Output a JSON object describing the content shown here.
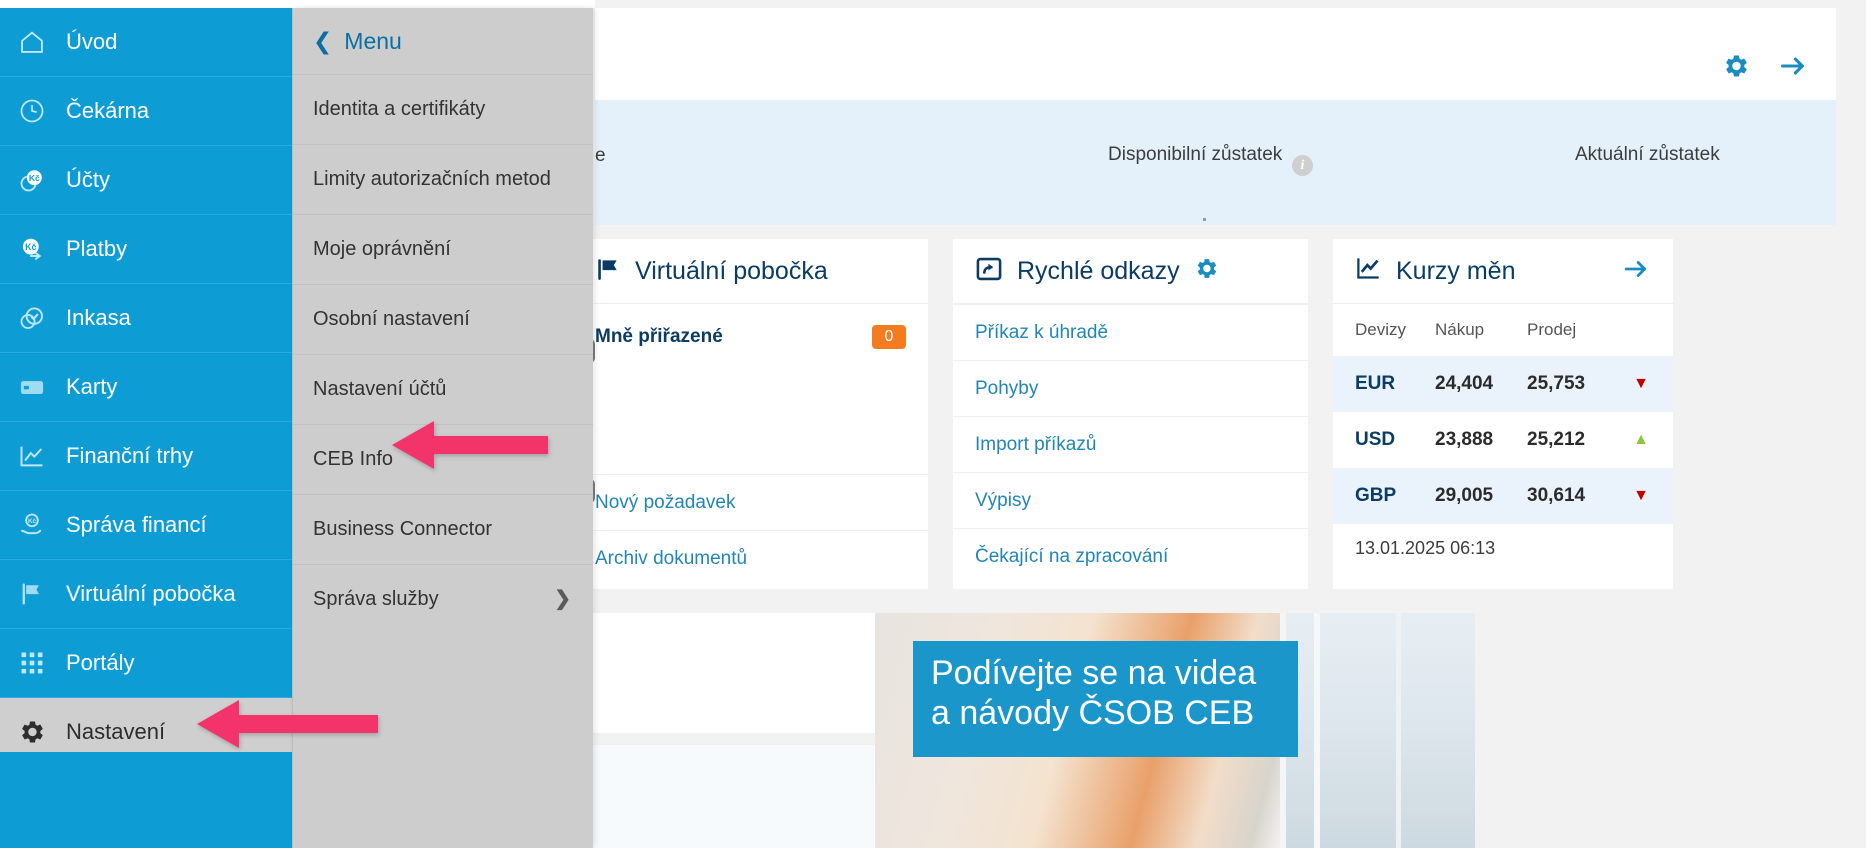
{
  "sidebar": {
    "items": [
      {
        "label": "Úvod",
        "icon": "home-icon",
        "selected": false
      },
      {
        "label": "Čekárna",
        "icon": "clock-icon",
        "selected": false
      },
      {
        "label": "Účty",
        "icon": "coins-icon",
        "selected": false
      },
      {
        "label": "Platby",
        "icon": "payment-icon",
        "selected": false
      },
      {
        "label": "Inkasa",
        "icon": "check-circle-icon",
        "selected": false
      },
      {
        "label": "Karty",
        "icon": "card-icon",
        "selected": false
      },
      {
        "label": "Finanční trhy",
        "icon": "chart-line-icon",
        "selected": false
      },
      {
        "label": "Správa financí",
        "icon": "hand-coin-icon",
        "selected": false
      },
      {
        "label": "Virtuální pobočka",
        "icon": "flag-icon",
        "selected": false
      },
      {
        "label": "Portály",
        "icon": "grid-icon",
        "selected": false
      },
      {
        "label": "Nastavení",
        "icon": "gear-icon",
        "selected": true
      }
    ]
  },
  "submenu": {
    "back_label": "Menu",
    "items": [
      {
        "label": "Identita a certifikáty",
        "has_children": false
      },
      {
        "label": "Limity autorizačních metod",
        "has_children": false
      },
      {
        "label": "Moje oprávnění",
        "has_children": false
      },
      {
        "label": "Osobní nastavení",
        "has_children": false
      },
      {
        "label": "Nastavení účtů",
        "has_children": false
      },
      {
        "label": "CEB Info",
        "has_children": false
      },
      {
        "label": "Business Connector",
        "has_children": false
      },
      {
        "label": "Správa služby",
        "has_children": true
      }
    ]
  },
  "balance_strip": {
    "account_label_tail": "e",
    "available_label": "Disponibilní zůstatek",
    "current_label": "Aktuální zůstatek"
  },
  "cards": {
    "virtual_branch": {
      "title": "Virtuální pobočka",
      "icon": "flag-icon",
      "assigned_label": "Mně přiřazené",
      "assigned_count": "0",
      "links": [
        "Nový požadavek",
        "Archiv dokumentů"
      ]
    },
    "quick_links": {
      "title": "Rychlé odkazy",
      "icon": "share-box-icon",
      "settings_icon": "gear-icon",
      "links": [
        "Příkaz k úhradě",
        "Pohyby",
        "Import příkazů",
        "Výpisy",
        "Čekající na zpracování"
      ]
    },
    "exchange_rates": {
      "title": "Kurzy měn",
      "icon": "chart-line-icon",
      "arrow_icon": "arrow-right-icon",
      "columns": [
        "Devizy",
        "Nákup",
        "Prodej"
      ],
      "rows": [
        {
          "currency": "EUR",
          "buy": "24,404",
          "sell": "25,753",
          "trend": "down"
        },
        {
          "currency": "USD",
          "buy": "23,888",
          "sell": "25,212",
          "trend": "up"
        },
        {
          "currency": "GBP",
          "buy": "29,005",
          "sell": "30,614",
          "trend": "down"
        }
      ],
      "timestamp": "13.01.2025 06:13"
    }
  },
  "counts": {
    "badge_a": "0",
    "link_count": "0",
    "badge_b": "0"
  },
  "promo": {
    "line1": "Podívejte se na videa",
    "line2": "a návody ČSOB CEB"
  },
  "colors": {
    "sidebar_blue": "#0d9dd4",
    "submenu_gray": "#cdcdcd",
    "accent_link": "#2286b5",
    "badge_orange": "#f47b20",
    "annotation_pink": "#f2346b",
    "trend_down": "#c00000",
    "trend_up": "#8cc63f"
  }
}
